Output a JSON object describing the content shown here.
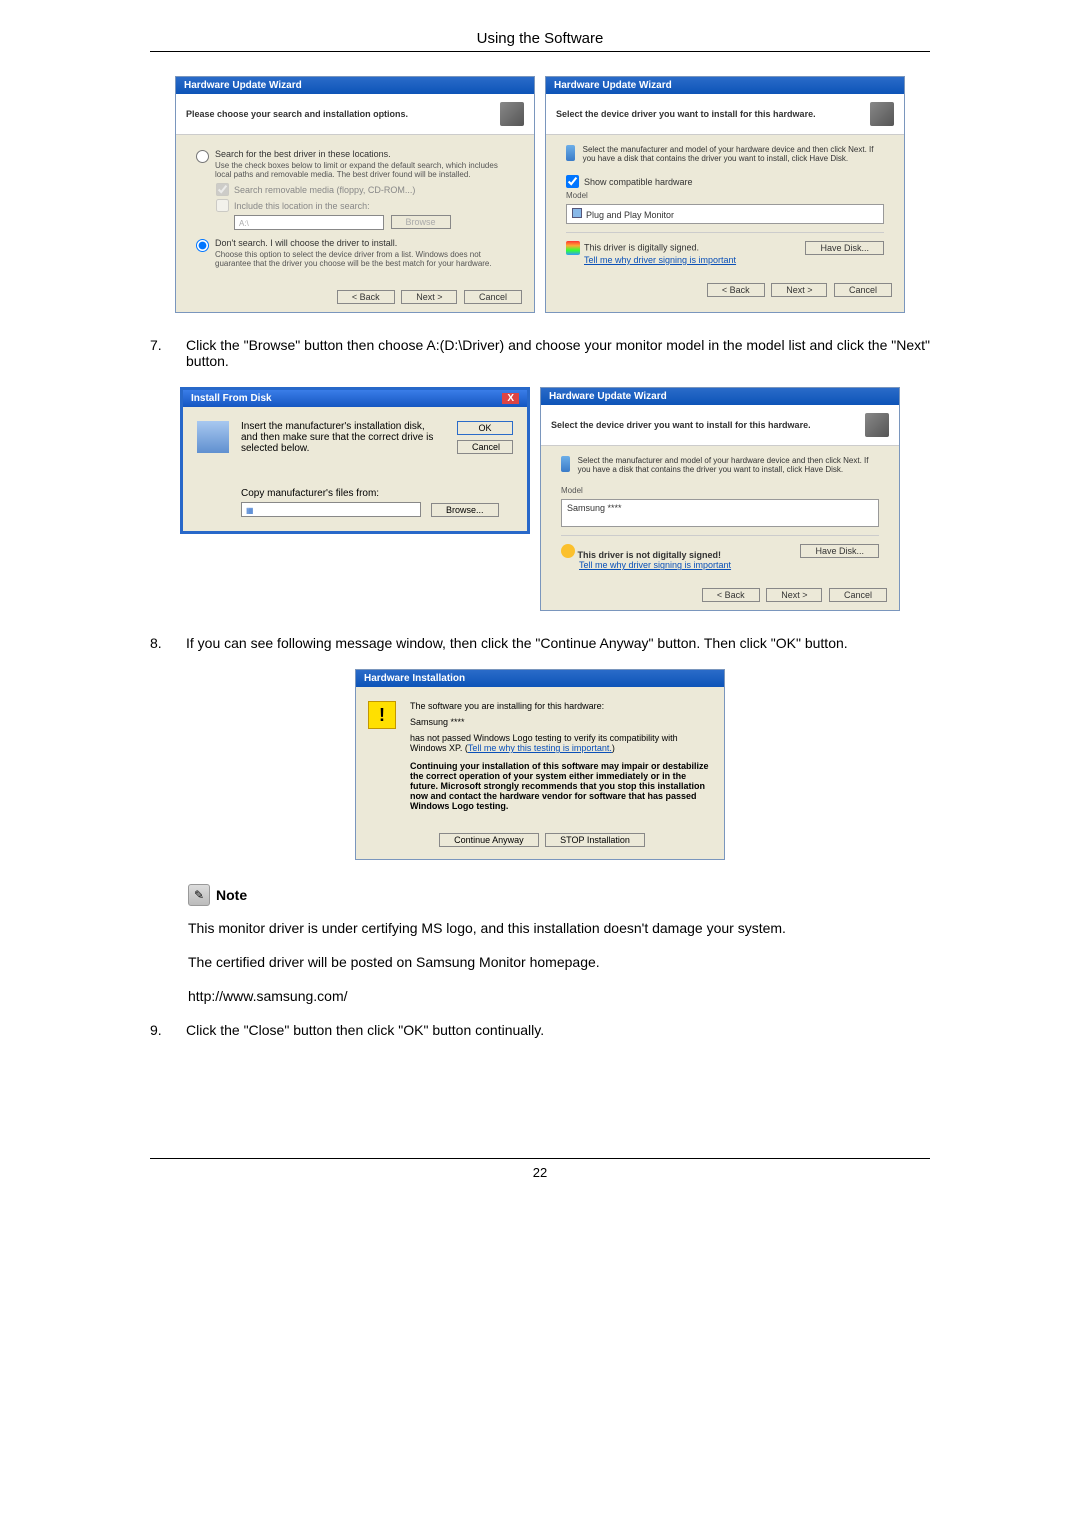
{
  "header": "Using the Software",
  "dlg1": {
    "title": "Hardware Update Wizard",
    "sub": "Please choose your search and installation options.",
    "r1": "Search for the best driver in these locations.",
    "r1_desc": "Use the check boxes below to limit or expand the default search, which includes local paths and removable media. The best driver found will be installed.",
    "chk1": "Search removable media (floppy, CD-ROM...)",
    "chk2": "Include this location in the search:",
    "path": "A:\\",
    "browse": "Browse",
    "r2": "Don't search. I will choose the driver to install.",
    "r2_desc": "Choose this option to select the device driver from a list. Windows does not guarantee that the driver you choose will be the best match for your hardware.",
    "back": "< Back",
    "next": "Next >",
    "cancel": "Cancel"
  },
  "dlg2": {
    "title": "Hardware Update Wizard",
    "sub": "Select the device driver you want to install for this hardware.",
    "instr": "Select the manufacturer and model of your hardware device and then click Next. If you have a disk that contains the driver you want to install, click Have Disk.",
    "show_compat": "Show compatible hardware",
    "model_label": "Model",
    "model_val": "Plug and Play Monitor",
    "signed": "This driver is digitally signed.",
    "tell": "Tell me why driver signing is important",
    "havedisk": "Have Disk...",
    "back": "< Back",
    "next": "Next >",
    "cancel": "Cancel"
  },
  "step7": {
    "num": "7.",
    "text": "Click the \"Browse\" button then choose A:(D:\\Driver) and choose your monitor model in the model list and click the \"Next\" button."
  },
  "ifd": {
    "title": "Install From Disk",
    "text": "Insert the manufacturer's installation disk, and then make sure that the correct drive is selected below.",
    "ok": "OK",
    "cancel": "Cancel",
    "copy": "Copy manufacturer's files from:",
    "browse": "Browse..."
  },
  "dlg3": {
    "title": "Hardware Update Wizard",
    "sub": "Select the device driver you want to install for this hardware.",
    "instr": "Select the manufacturer and model of your hardware device and then click Next. If you have a disk that contains the driver you want to install, click Have Disk.",
    "model_label": "Model",
    "model_val": "Samsung ****",
    "not_signed": "This driver is not digitally signed!",
    "tell": "Tell me why driver signing is important",
    "havedisk": "Have Disk...",
    "back": "< Back",
    "next": "Next >",
    "cancel": "Cancel"
  },
  "step8": {
    "num": "8.",
    "text": "If you can see following message window, then click the \"Continue Anyway\" button. Then click \"OK\" button."
  },
  "hw": {
    "title": "Hardware Installation",
    "line1": "The software you are installing for this hardware:",
    "device": "Samsung ****",
    "line2_a": "has not passed Windows Logo testing to verify its compatibility with Windows XP. (",
    "line2_link": "Tell me why this testing is important.",
    "line2_b": ")",
    "warn": "Continuing your installation of this software may impair or destabilize the correct operation of your system either immediately or in the future. Microsoft strongly recommends that you stop this installation now and contact the hardware vendor for software that has passed Windows Logo testing.",
    "cont": "Continue Anyway",
    "stop": "STOP Installation"
  },
  "note_label": "Note",
  "note_p1": "This monitor driver is under certifying MS logo, and this installation doesn't damage your system.",
  "note_p2": "The certified driver will be posted on Samsung Monitor homepage.",
  "url": "http://www.samsung.com/",
  "step9": {
    "num": "9.",
    "text": "Click the \"Close\" button then click \"OK\" button continually."
  },
  "page_num": "22"
}
